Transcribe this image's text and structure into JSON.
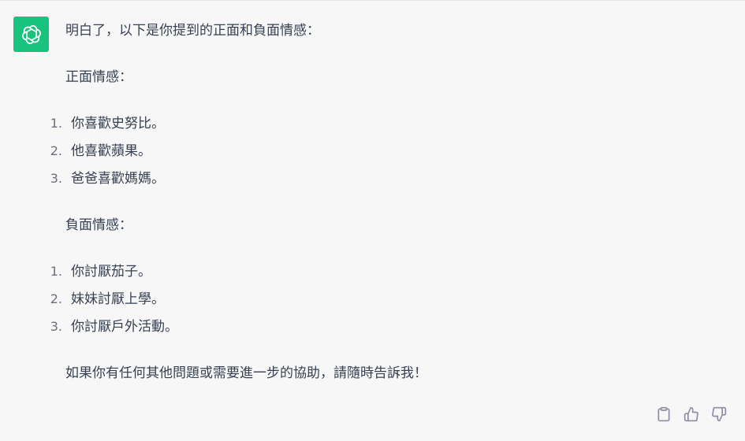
{
  "message": {
    "intro": "明白了，以下是你提到的正面和負面情感：",
    "positive": {
      "heading": "正面情感：",
      "items": [
        {
          "num": "1.",
          "text": "你喜歡史努比。"
        },
        {
          "num": "2.",
          "text": "他喜歡蘋果。"
        },
        {
          "num": "3.",
          "text": "爸爸喜歡媽媽。"
        }
      ]
    },
    "negative": {
      "heading": "負面情感：",
      "items": [
        {
          "num": "1.",
          "text": "你討厭茄子。"
        },
        {
          "num": "2.",
          "text": "妹妹討厭上學。"
        },
        {
          "num": "3.",
          "text": "你討厭戶外活動。"
        }
      ]
    },
    "closing": "如果你有任何其他問題或需要進一步的協助，請隨時告訴我！"
  },
  "colors": {
    "avatar_bg": "#19c37d",
    "background": "#f7f7f8",
    "text": "#374151",
    "icon": "#8e8ea0"
  },
  "icons": {
    "avatar": "openai-logo-icon",
    "copy": "clipboard-icon",
    "like": "thumbs-up-icon",
    "dislike": "thumbs-down-icon"
  }
}
